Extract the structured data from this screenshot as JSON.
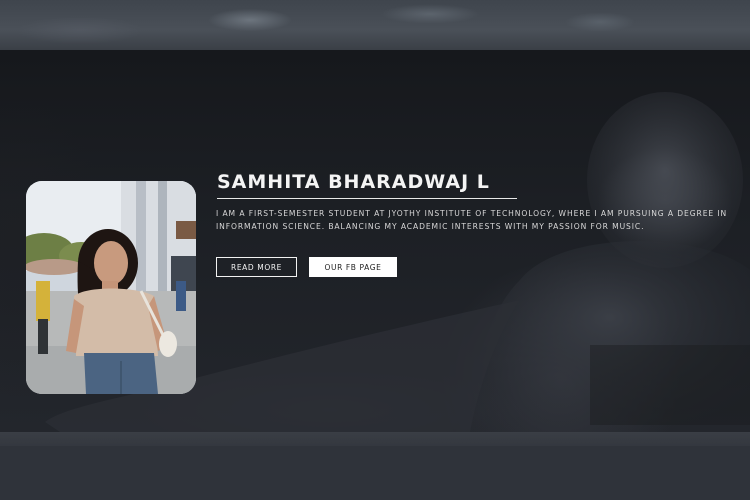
{
  "profile": {
    "name": "SAMHITA BHARADWAJ L",
    "bio": "I AM A FIRST-SEMESTER STUDENT AT JYOTHY INSTITUTE OF TECHNOLOGY, WHERE I AM PURSUING A DEGREE IN INFORMATION SCIENCE. BALANCING MY ACADEMIC INTERESTS WITH MY PASSION FOR MUSIC.",
    "photo_alt": "profile-photo"
  },
  "buttons": {
    "read_more": "READ MORE",
    "fb_page": "OUR FB PAGE"
  },
  "colors": {
    "hero_background": "#1c1f24",
    "text": "#f4f4f4",
    "button_fill": "#ffffff"
  }
}
